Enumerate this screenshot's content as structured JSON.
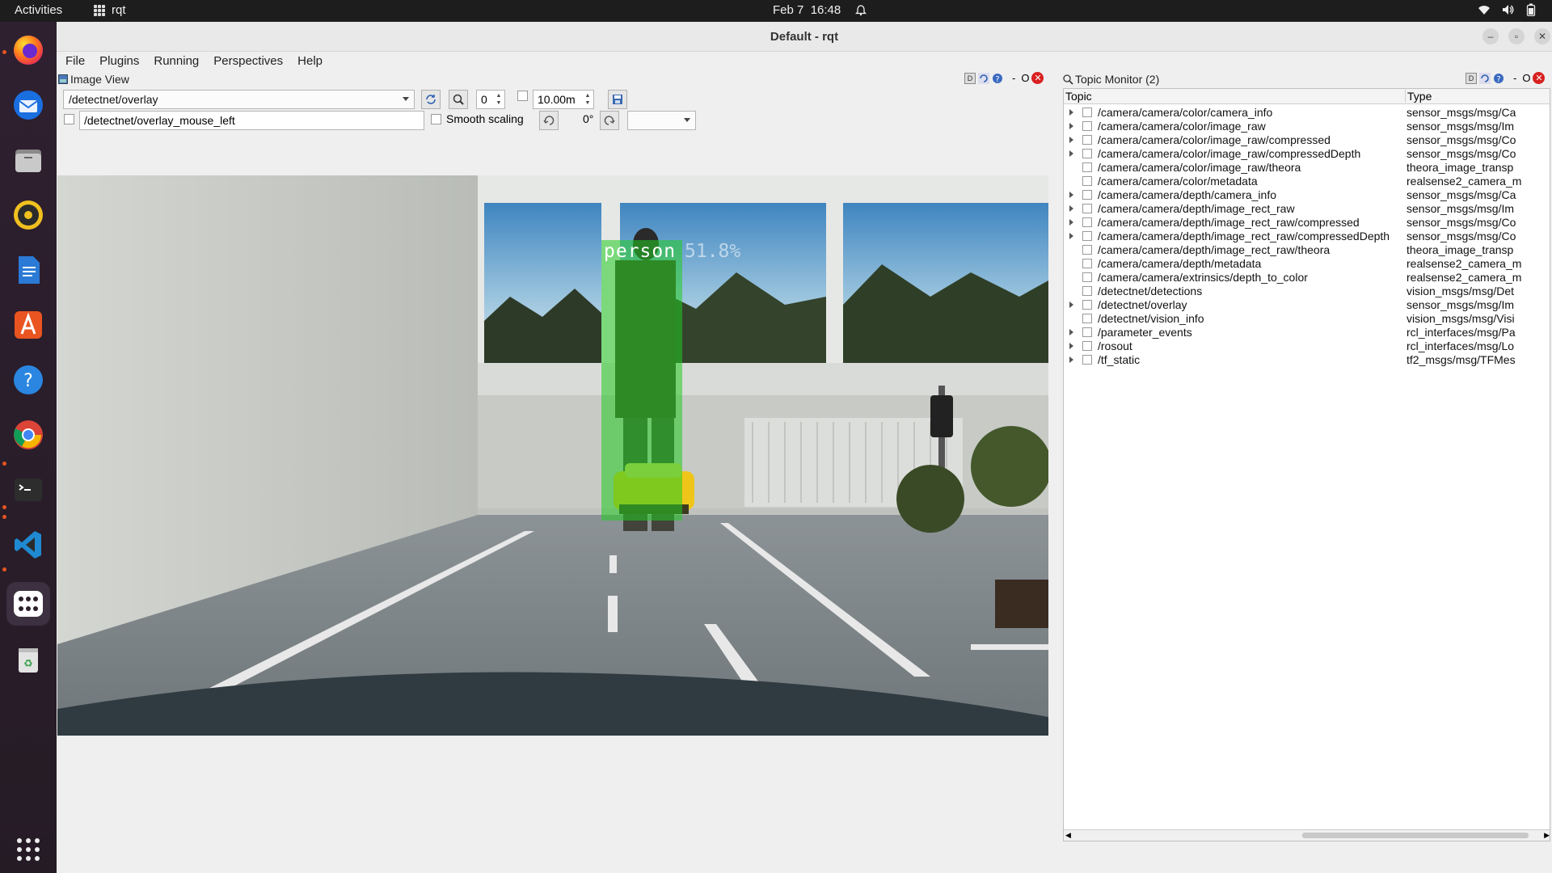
{
  "topbar": {
    "activities": "Activities",
    "app": "rqt",
    "date": "Feb 7",
    "time": "16:48"
  },
  "dock": {
    "items": [
      "firefox-icon",
      "thunderbird-icon",
      "files-icon",
      "rhythmbox-icon",
      "writer-icon",
      "app-center-icon",
      "help-icon",
      "chrome-icon",
      "terminal-icon",
      "vscode-icon",
      "workspaces-icon",
      "trash-icon",
      "show-apps-icon"
    ]
  },
  "window": {
    "title": "Default - rqt",
    "menus": [
      "File",
      "Plugins",
      "Running",
      "Perspectives",
      "Help"
    ]
  },
  "image_view": {
    "title": "Image View",
    "topic": "/detectnet/overlay",
    "rotation_index": "0",
    "max_depth": "10.00m",
    "mouse_topic": "/detectnet/overlay_mouse_left",
    "smooth_scaling": "Smooth scaling",
    "rotation": "0°",
    "detection_label": "person",
    "detection_conf": "51.8%",
    "detection_color": "#22cc22"
  },
  "topic_monitor": {
    "title": "Topic Monitor (2)",
    "columns": [
      "Topic",
      "Type"
    ],
    "rows": [
      {
        "topic": "/camera/camera/color/camera_info",
        "type": "sensor_msgs/msg/Ca",
        "expandable": true
      },
      {
        "topic": "/camera/camera/color/image_raw",
        "type": "sensor_msgs/msg/Im",
        "expandable": true
      },
      {
        "topic": "/camera/camera/color/image_raw/compressed",
        "type": "sensor_msgs/msg/Co",
        "expandable": true
      },
      {
        "topic": "/camera/camera/color/image_raw/compressedDepth",
        "type": "sensor_msgs/msg/Co",
        "expandable": true
      },
      {
        "topic": "/camera/camera/color/image_raw/theora",
        "type": "theora_image_transp",
        "expandable": false
      },
      {
        "topic": "/camera/camera/color/metadata",
        "type": "realsense2_camera_m",
        "expandable": false
      },
      {
        "topic": "/camera/camera/depth/camera_info",
        "type": "sensor_msgs/msg/Ca",
        "expandable": true
      },
      {
        "topic": "/camera/camera/depth/image_rect_raw",
        "type": "sensor_msgs/msg/Im",
        "expandable": true
      },
      {
        "topic": "/camera/camera/depth/image_rect_raw/compressed",
        "type": "sensor_msgs/msg/Co",
        "expandable": true
      },
      {
        "topic": "/camera/camera/depth/image_rect_raw/compressedDepth",
        "type": "sensor_msgs/msg/Co",
        "expandable": true
      },
      {
        "topic": "/camera/camera/depth/image_rect_raw/theora",
        "type": "theora_image_transp",
        "expandable": false
      },
      {
        "topic": "/camera/camera/depth/metadata",
        "type": "realsense2_camera_m",
        "expandable": false
      },
      {
        "topic": "/camera/camera/extrinsics/depth_to_color",
        "type": "realsense2_camera_m",
        "expandable": false
      },
      {
        "topic": "/detectnet/detections",
        "type": "vision_msgs/msg/Det",
        "expandable": false
      },
      {
        "topic": "/detectnet/overlay",
        "type": "sensor_msgs/msg/Im",
        "expandable": true
      },
      {
        "topic": "/detectnet/vision_info",
        "type": "vision_msgs/msg/Visi",
        "expandable": false
      },
      {
        "topic": "/parameter_events",
        "type": "rcl_interfaces/msg/Pa",
        "expandable": true
      },
      {
        "topic": "/rosout",
        "type": "rcl_interfaces/msg/Lo",
        "expandable": true
      },
      {
        "topic": "/tf_static",
        "type": "tf2_msgs/msg/TFMes",
        "expandable": true
      }
    ]
  }
}
